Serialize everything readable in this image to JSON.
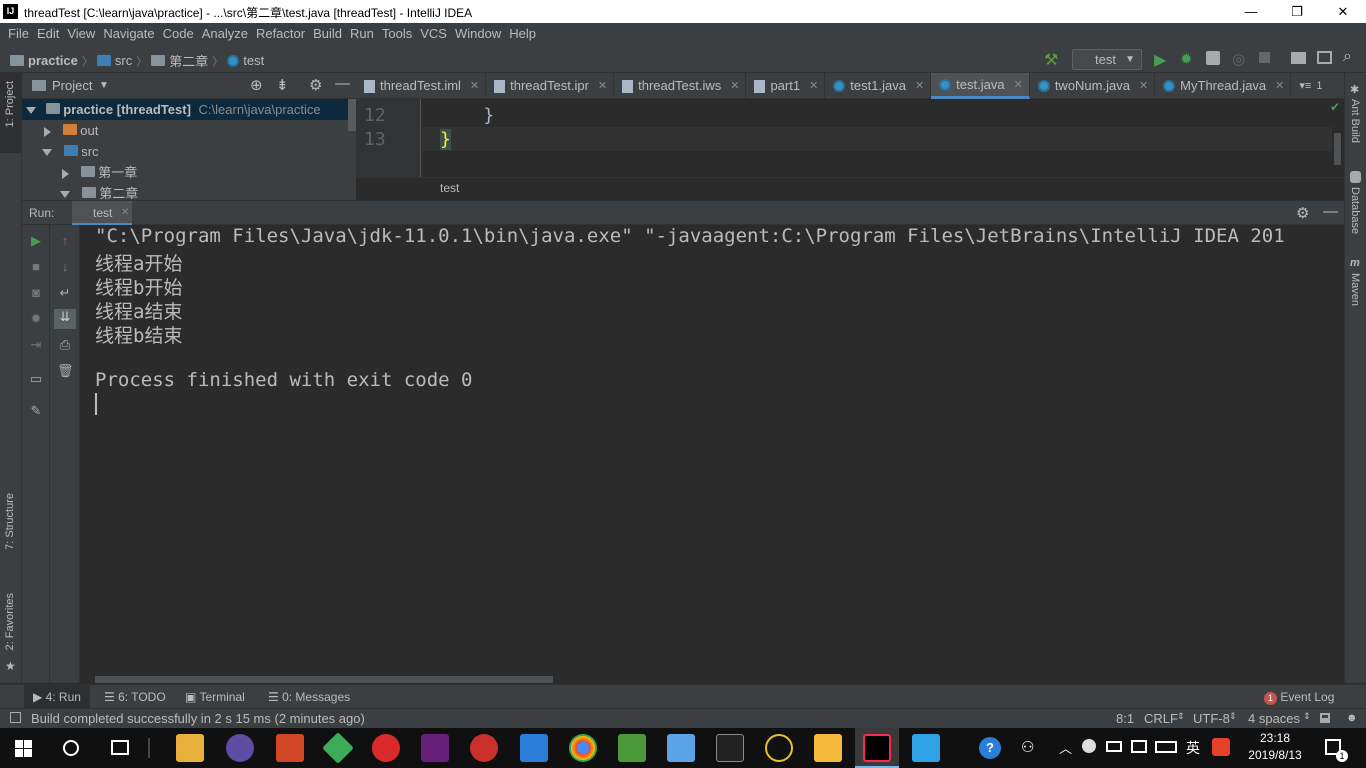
{
  "window": {
    "title": "threadTest [C:\\learn\\java\\practice] - ...\\src\\第二章\\test.java [threadTest] - IntelliJ IDEA",
    "logo_text": "IJ",
    "minimize": "—",
    "restore": "❐",
    "close": "✕"
  },
  "menu": [
    "File",
    "Edit",
    "View",
    "Navigate",
    "Code",
    "Analyze",
    "Refactor",
    "Build",
    "Run",
    "Tools",
    "VCS",
    "Window",
    "Help"
  ],
  "navbar": {
    "crumbs": [
      "practice",
      "src",
      "第二章",
      "test"
    ],
    "run_config": "test"
  },
  "left_strip": {
    "project": "1: Project",
    "structure": "7: Structure",
    "favorites": "2: Favorites"
  },
  "right_strip": {
    "ant": "Ant Build",
    "database": "Database",
    "maven": "Maven"
  },
  "project_panel": {
    "title": "Project",
    "tree": [
      {
        "label": "practice",
        "module": "[threadTest]",
        "path": "C:\\learn\\java\\practice"
      },
      {
        "label": "out"
      },
      {
        "label": "src"
      },
      {
        "label": "第一章"
      },
      {
        "label": "第二章"
      }
    ]
  },
  "editor": {
    "tabs": [
      {
        "label": "threadTest.iml"
      },
      {
        "label": "threadTest.ipr"
      },
      {
        "label": "threadTest.iws"
      },
      {
        "label": "part1"
      },
      {
        "label": "test1.java"
      },
      {
        "label": "test.java"
      },
      {
        "label": "twoNum.java"
      },
      {
        "label": "MyThread.java"
      }
    ],
    "tab_overflow": "1",
    "lines": [
      {
        "no": "12",
        "code": "    }"
      },
      {
        "no": "13",
        "code": "}"
      }
    ],
    "breadcrumb": "test"
  },
  "run_panel": {
    "label": "Run:",
    "tab": "test",
    "console": [
      "\"C:\\Program Files\\Java\\jdk-11.0.1\\bin\\java.exe\" \"-javaagent:C:\\Program Files\\JetBrains\\IntelliJ IDEA 201",
      "线程a开始",
      "线程b开始",
      "线程a结束",
      "线程b结束",
      "",
      "Process finished with exit code 0"
    ]
  },
  "bottom_tabs": {
    "run": "4: Run",
    "todo": "6: TODO",
    "terminal": "Terminal",
    "messages": "0: Messages",
    "event_log": "Event Log",
    "event_count": "1"
  },
  "status": {
    "message": "Build completed successfully in 2 s 15 ms (2 minutes ago)",
    "position": "8:1",
    "line_sep": "CRLF",
    "encoding": "UTF-8",
    "indent": "4 spaces"
  },
  "taskbar": {
    "time": "23:18",
    "date": "2019/8/13",
    "ime": "英",
    "notifications": "1"
  }
}
